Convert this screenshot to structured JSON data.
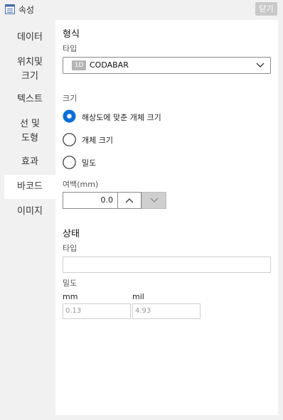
{
  "window": {
    "title": "속성",
    "close_label": "닫기"
  },
  "sidebar": {
    "items": [
      {
        "label_lines": [
          "데이터"
        ]
      },
      {
        "label_lines": [
          "위치및",
          "크기"
        ]
      },
      {
        "label_lines": [
          "텍스트"
        ]
      },
      {
        "label_lines": [
          "선 및",
          "도형"
        ]
      },
      {
        "label_lines": [
          "효과"
        ]
      },
      {
        "label_lines": [
          "바코드"
        ],
        "active": true
      },
      {
        "label_lines": [
          "이미지"
        ]
      }
    ]
  },
  "format": {
    "heading": "형식",
    "type_label": "타입",
    "type_badge": "1D",
    "type_value": "CODABAR"
  },
  "size": {
    "label": "크기",
    "options": [
      {
        "label": "해상도에 맞춘 개체 크기",
        "checked": true
      },
      {
        "label": "개체 크기",
        "checked": false
      },
      {
        "label": "밀도",
        "checked": false
      }
    ]
  },
  "margin": {
    "label": "여백(mm)",
    "value": "0.0"
  },
  "state": {
    "heading": "상태",
    "type_label": "타입",
    "type_value": "",
    "density_label": "밀도",
    "mm_label": "mm",
    "mil_label": "mil",
    "mm_value": "0.13",
    "mil_value": "4.93"
  },
  "colors": {
    "accent": "#0a6fd6",
    "panel": "#ffffff",
    "background": "#f1f1f1"
  },
  "icons": {
    "title": "property-sheet-icon",
    "dropdown": "chevron-down-icon",
    "step_up": "chevron-up-icon",
    "step_down": "chevron-down-icon"
  }
}
